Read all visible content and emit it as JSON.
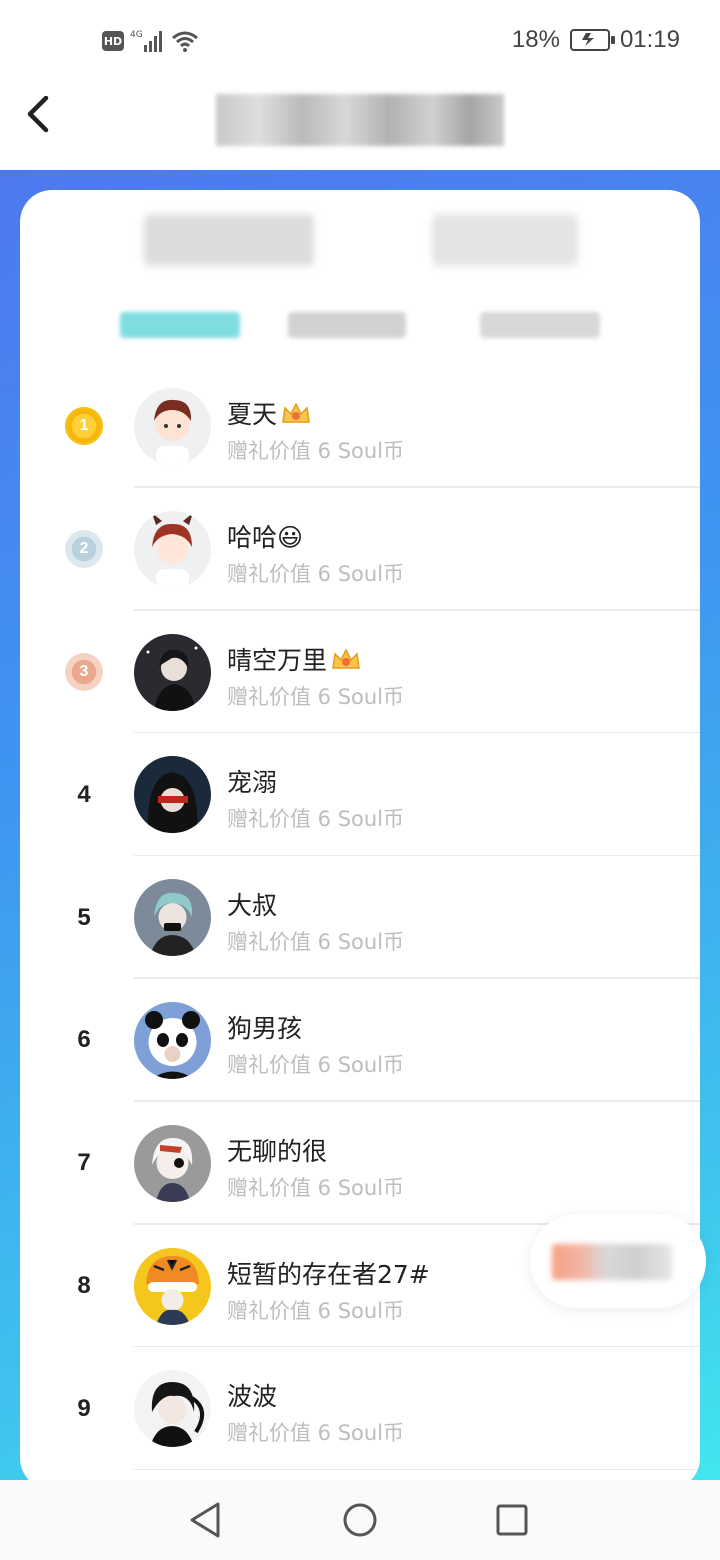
{
  "status_bar": {
    "network_badge": "HD",
    "network_type": "4G",
    "battery_percent": "18%",
    "time": "01:19",
    "icons": [
      "signal-icon",
      "wifi-icon",
      "battery-charging-icon"
    ]
  },
  "nav": {
    "back_icon": "chevron-left-icon"
  },
  "colors": {
    "gradient_start": "#4f78ef",
    "gradient_end": "#42e6ee",
    "medal_gold": "#f6b60a",
    "medal_silver": "#b8d1dc",
    "medal_bronze": "#e7a88d",
    "secondary_text": "#bdbdbd"
  },
  "ranking": [
    {
      "rank": "1",
      "name": "夏天",
      "badge": "crown-icon",
      "value_text": "赠礼价值 6 Soul币"
    },
    {
      "rank": "2",
      "name": "哈哈😃",
      "badge": "",
      "value_text": "赠礼价值 6 Soul币"
    },
    {
      "rank": "3",
      "name": "晴空万里",
      "badge": "crown-icon",
      "value_text": "赠礼价值 6 Soul币"
    },
    {
      "rank": "4",
      "name": "宠溺",
      "badge": "",
      "value_text": "赠礼价值 6 Soul币"
    },
    {
      "rank": "5",
      "name": "大叔",
      "badge": "",
      "value_text": "赠礼价值 6 Soul币"
    },
    {
      "rank": "6",
      "name": "狗男孩",
      "badge": "",
      "value_text": "赠礼价值 6 Soul币"
    },
    {
      "rank": "7",
      "name": "无聊的很",
      "badge": "",
      "value_text": "赠礼价值 6 Soul币"
    },
    {
      "rank": "8",
      "name": "短暂的存在者27#",
      "badge": "",
      "value_text": "赠礼价值 6 Soul币"
    },
    {
      "rank": "9",
      "name": "波波",
      "badge": "",
      "value_text": "赠礼价值 6 Soul币"
    }
  ],
  "system_nav": {
    "back": "triangle-back-icon",
    "home": "circle-home-icon",
    "recents": "square-recents-icon"
  }
}
